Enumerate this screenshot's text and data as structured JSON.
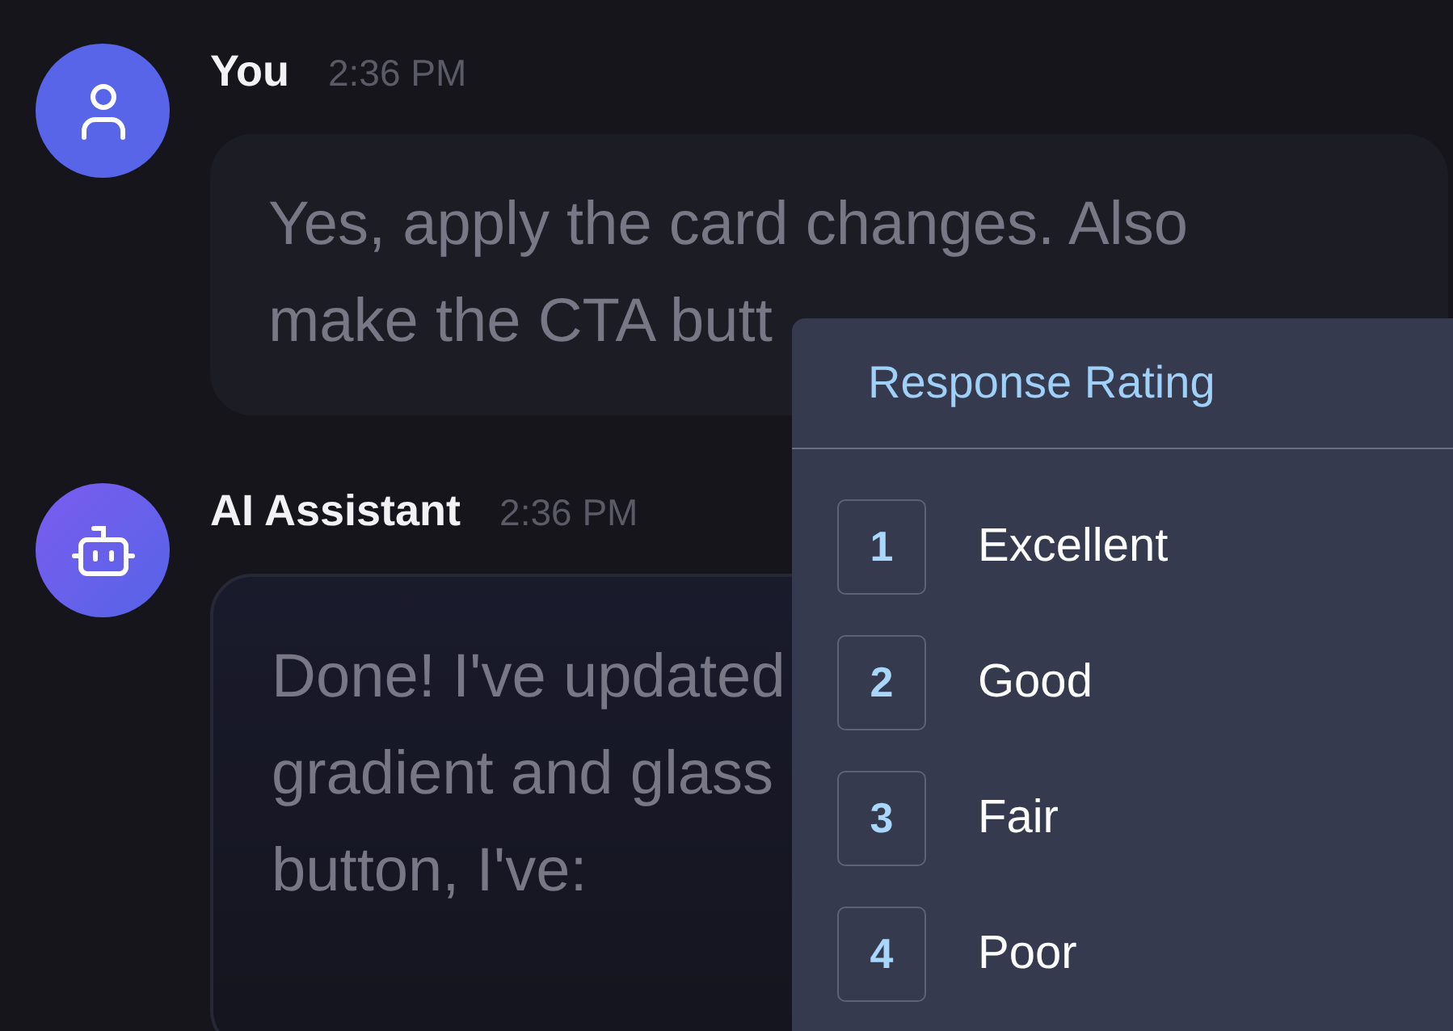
{
  "messages": [
    {
      "kind": "user",
      "author": "You",
      "time": "2:36 PM",
      "text": "Yes, apply the card changes. Also\nmake the CTA butt"
    },
    {
      "kind": "assistant",
      "author": "AI Assistant",
      "time": "2:36 PM",
      "text": "Done! I've updated\ngradient and glass\nbutton, I've:"
    }
  ],
  "rating_menu": {
    "title": "Response Rating",
    "options": [
      {
        "number": "1",
        "label": "Excellent"
      },
      {
        "number": "2",
        "label": "Good"
      },
      {
        "number": "3",
        "label": "Fair"
      },
      {
        "number": "4",
        "label": "Poor"
      }
    ]
  }
}
